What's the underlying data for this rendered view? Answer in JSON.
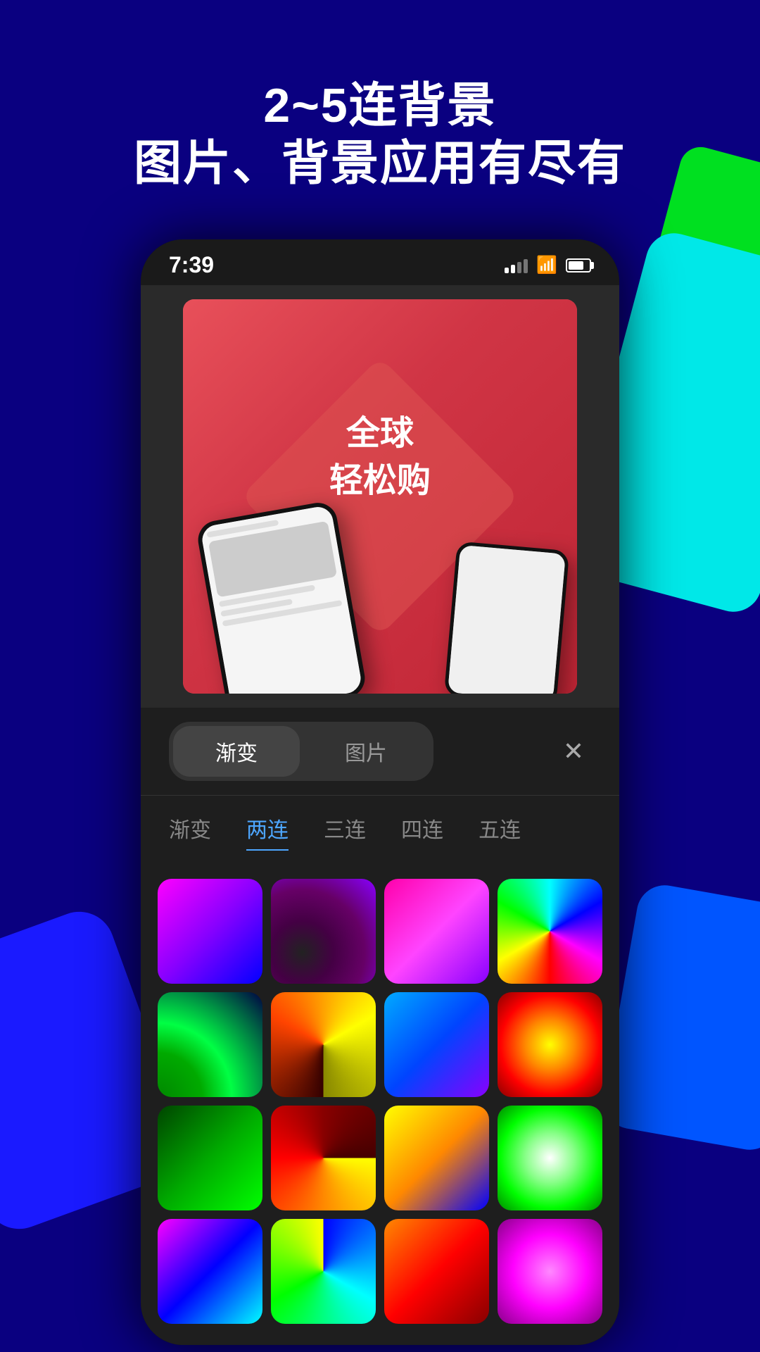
{
  "background": {
    "color": "#0a0080"
  },
  "header": {
    "title_line1": "2~5连背景",
    "title_line2": "图片、背景应用有尽有"
  },
  "status_bar": {
    "time": "7:39",
    "signal_label": "signal",
    "wifi_label": "wifi",
    "battery_label": "battery"
  },
  "preview": {
    "text_line1": "全球",
    "text_line2": "轻松购"
  },
  "tabs": {
    "main": [
      {
        "id": "gradient",
        "label": "渐变",
        "active": true
      },
      {
        "id": "image",
        "label": "图片",
        "active": false
      }
    ],
    "sub": [
      {
        "id": "gradient",
        "label": "渐变",
        "active": false
      },
      {
        "id": "two",
        "label": "两连",
        "active": true
      },
      {
        "id": "three",
        "label": "三连",
        "active": false
      },
      {
        "id": "four",
        "label": "四连",
        "active": false
      },
      {
        "id": "five",
        "label": "五连",
        "active": false
      }
    ]
  },
  "icons": {
    "close": "✕",
    "wifi": "📶",
    "signal": "signal-bars"
  },
  "swatches": [
    {
      "id": 1,
      "class": "swatch-1"
    },
    {
      "id": 2,
      "class": "swatch-2"
    },
    {
      "id": 3,
      "class": "swatch-3"
    },
    {
      "id": 4,
      "class": "swatch-4"
    },
    {
      "id": 5,
      "class": "swatch-5"
    },
    {
      "id": 6,
      "class": "swatch-6"
    },
    {
      "id": 7,
      "class": "swatch-7"
    },
    {
      "id": 8,
      "class": "swatch-8"
    },
    {
      "id": 9,
      "class": "swatch-9"
    },
    {
      "id": 10,
      "class": "swatch-10"
    },
    {
      "id": 11,
      "class": "swatch-11"
    },
    {
      "id": 12,
      "class": "swatch-12"
    },
    {
      "id": 13,
      "class": "swatch-13"
    },
    {
      "id": 14,
      "class": "swatch-14"
    },
    {
      "id": 15,
      "class": "swatch-15"
    },
    {
      "id": 16,
      "class": "swatch-16"
    }
  ]
}
